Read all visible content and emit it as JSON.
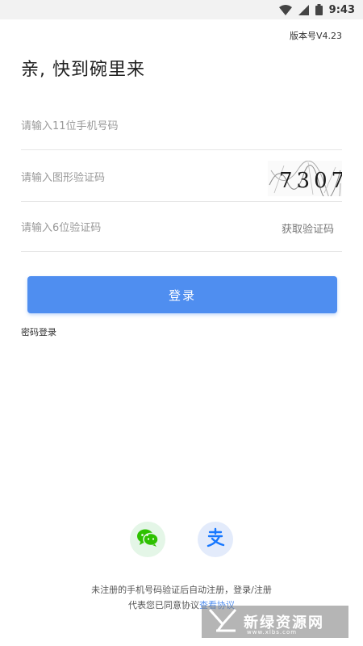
{
  "status_bar": {
    "time": "9:43"
  },
  "header": {
    "version": "版本号V4.23",
    "title": "亲, 快到碗里来"
  },
  "form": {
    "phone_placeholder": "请输入11位手机号码",
    "captcha_placeholder": "请输入图形验证码",
    "captcha_text": "7307",
    "sms_placeholder": "请输入6位验证码",
    "get_code_label": "获取验证码",
    "login_label": "登录",
    "password_login_label": "密码登录"
  },
  "social_login": [
    {
      "name": "wechat",
      "icon": "wechat-icon",
      "color": "#2dc100"
    },
    {
      "name": "alipay",
      "icon": "alipay-icon",
      "color": "#1677ff"
    }
  ],
  "agreement": {
    "line1": "未注册的手机号码验证后自动注册，登录/注册",
    "line2_prefix": "代表您已同意协议",
    "link": "查看协议"
  },
  "watermark": {
    "text": "新绿资源网",
    "sub": "www.xlbs.com"
  },
  "colors": {
    "primary": "#4f8ef0",
    "divider": "#e6e6e6"
  }
}
